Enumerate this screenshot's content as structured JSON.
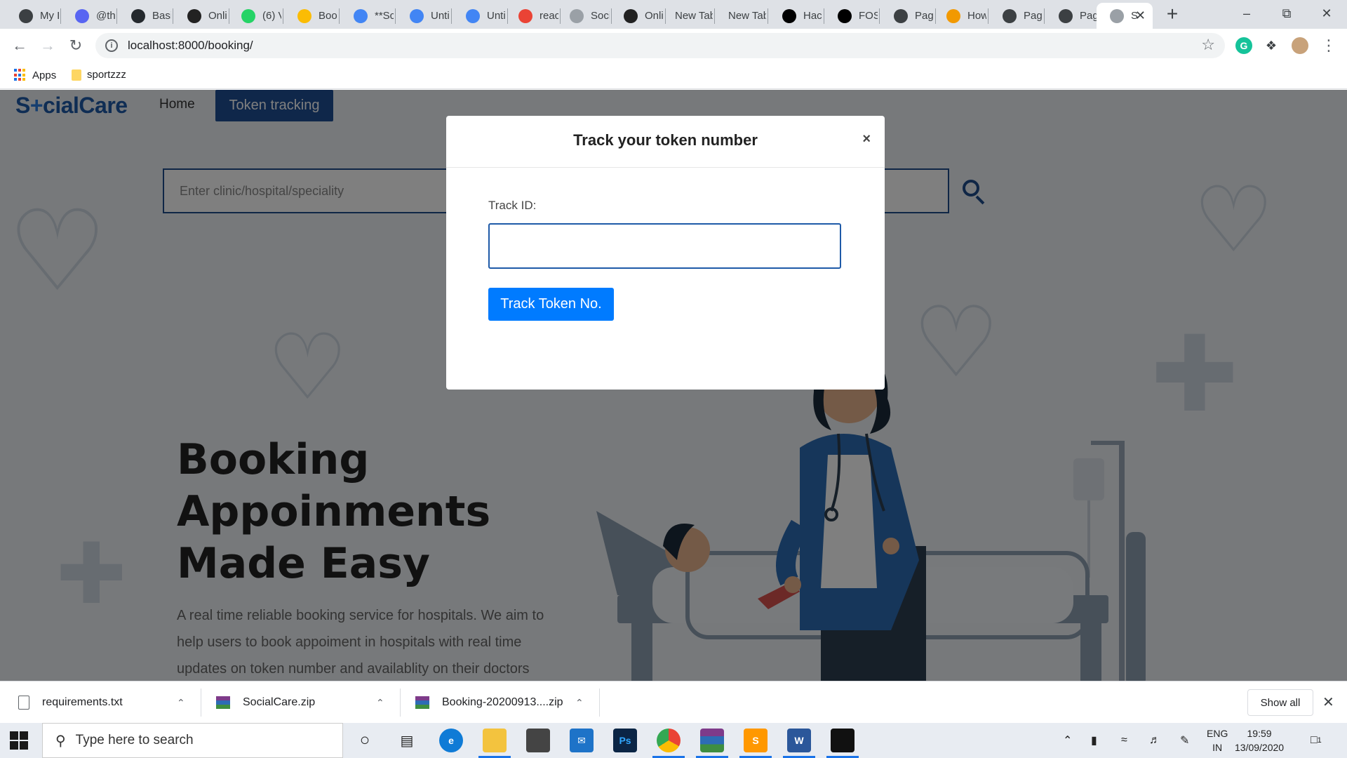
{
  "browser": {
    "tabs": [
      {
        "title": "My I",
        "favicon": "web-icon",
        "color": "#3c4043"
      },
      {
        "title": "@th",
        "favicon": "discord-icon",
        "color": "#5865f2"
      },
      {
        "title": "Basi",
        "favicon": "github-icon",
        "color": "#24292e"
      },
      {
        "title": "Onli",
        "favicon": "d-icon",
        "color": "#222222"
      },
      {
        "title": "(6) V",
        "favicon": "whatsapp-icon",
        "color": "#25d366"
      },
      {
        "title": "Boo",
        "favicon": "drive-icon",
        "color": "#fbbc04"
      },
      {
        "title": "**Sc",
        "favicon": "docs-icon",
        "color": "#4285f4"
      },
      {
        "title": "Unti",
        "favicon": "docs-icon",
        "color": "#4285f4"
      },
      {
        "title": "Unti",
        "favicon": "docs-icon",
        "color": "#4285f4"
      },
      {
        "title": "reac",
        "favicon": "google-icon",
        "color": "#ea4335"
      },
      {
        "title": "Soci",
        "favicon": "socialcare-icon",
        "color": "#9aa0a6"
      },
      {
        "title": "Onli",
        "favicon": "d-icon",
        "color": "#222222"
      },
      {
        "title": "New Tab",
        "favicon": "",
        "color": ""
      },
      {
        "title": "New Tab",
        "favicon": "",
        "color": ""
      },
      {
        "title": "Hac",
        "favicon": "fu-icon",
        "color": "#000000"
      },
      {
        "title": "FOS",
        "favicon": "fu-icon",
        "color": "#000000"
      },
      {
        "title": "Pag",
        "favicon": "web-icon",
        "color": "#3c4043"
      },
      {
        "title": "How",
        "favicon": "pen-icon",
        "color": "#f29900"
      },
      {
        "title": "Pag",
        "favicon": "web-icon",
        "color": "#3c4043"
      },
      {
        "title": "Pag",
        "favicon": "web-icon",
        "color": "#3c4043"
      },
      {
        "title": "S",
        "favicon": "socialcare-icon",
        "color": "#9aa0a6",
        "active": true
      }
    ],
    "url": "localhost:8000/booking/",
    "bookmarks": [
      {
        "label": "Apps",
        "icon": "apps-grid-icon"
      },
      {
        "label": "sportzzz",
        "icon": "folder-icon"
      }
    ]
  },
  "site": {
    "brand": "S+cialCare",
    "brand_parts": [
      "S",
      "+",
      "cialCare"
    ],
    "nav": {
      "home": "Home",
      "token_tracking": "Token tracking"
    },
    "search_placeholder": "Enter clinic/hospital/speciality",
    "hero_title_lines": [
      "Booking",
      "Appoinments",
      "Made Easy"
    ],
    "hero_description": "A real time reliable booking service for hospitals. We aim to help users to book appoiment in hospitals with real time updates on token number and availablity on their doctors"
  },
  "modal": {
    "title": "Track your token number",
    "close": "×",
    "label": "Track ID:",
    "input_value": "",
    "button": "Track Token No."
  },
  "downloads": {
    "items": [
      {
        "name": "requirements.txt",
        "icon": "text-file-icon"
      },
      {
        "name": "SocialCare.zip",
        "icon": "winrar-icon"
      },
      {
        "name": "Booking-20200913....zip",
        "icon": "winrar-icon"
      }
    ],
    "show_all": "Show all"
  },
  "taskbar": {
    "search_placeholder": "Type here to search",
    "apps": [
      "cortana-icon",
      "task-view-icon",
      "edge-icon",
      "file-explorer-icon",
      "store-icon",
      "mail-icon",
      "photoshop-icon",
      "chrome-icon",
      "winrar-icon",
      "sublime-icon",
      "word-icon",
      "terminal-icon"
    ],
    "lang_top": "ENG",
    "lang_bottom": "IN",
    "time": "19:59",
    "date": "13/09/2020",
    "notification_count": "1"
  },
  "colors": {
    "brand_blue": "#1e5aa8",
    "nav_active": "#1f4f94",
    "button_primary": "#007bff",
    "overlay": "rgba(0,0,0,0.5)"
  }
}
